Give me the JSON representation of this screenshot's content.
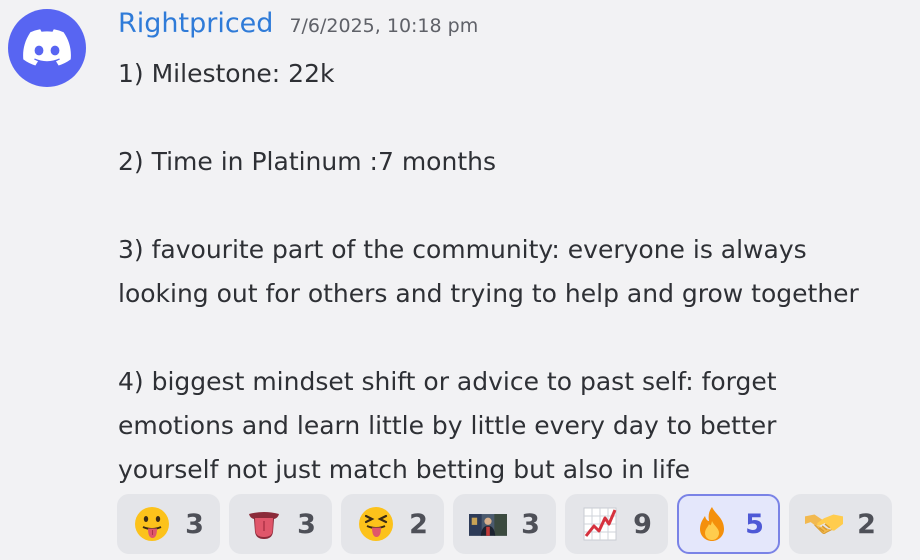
{
  "author": {
    "name": "Rightpriced",
    "avatar_icon": "discord-logo-icon",
    "avatar_color": "#5865f2",
    "name_color": "#2f7bd8"
  },
  "timestamp": "7/6/2025, 10:18 pm",
  "message": {
    "line1": "1) Milestone: 22k",
    "line2": "2) Time in Platinum :7 months",
    "line3a": "3) favourite part of the community: everyone is always",
    "line3b": "looking out for others and trying to help and grow together",
    "line4a": "4) biggest mindset shift or advice to past self: forget",
    "line4b": "emotions and learn little by little every day to better",
    "line4c": "yourself not just match betting but also in life"
  },
  "reactions": [
    {
      "emoji": "face-with-tongue-icon",
      "count": "3",
      "active": false
    },
    {
      "emoji": "tongue-icon",
      "count": "3",
      "active": false
    },
    {
      "emoji": "squinting-face-with-tongue-icon",
      "count": "2",
      "active": false
    },
    {
      "emoji": "custom-photo-emoji-icon",
      "count": "3",
      "active": false
    },
    {
      "emoji": "chart-increasing-icon",
      "count": "9",
      "active": false
    },
    {
      "emoji": "fire-icon",
      "count": "5",
      "active": true
    },
    {
      "emoji": "handshake-icon",
      "count": "2",
      "active": false
    }
  ]
}
